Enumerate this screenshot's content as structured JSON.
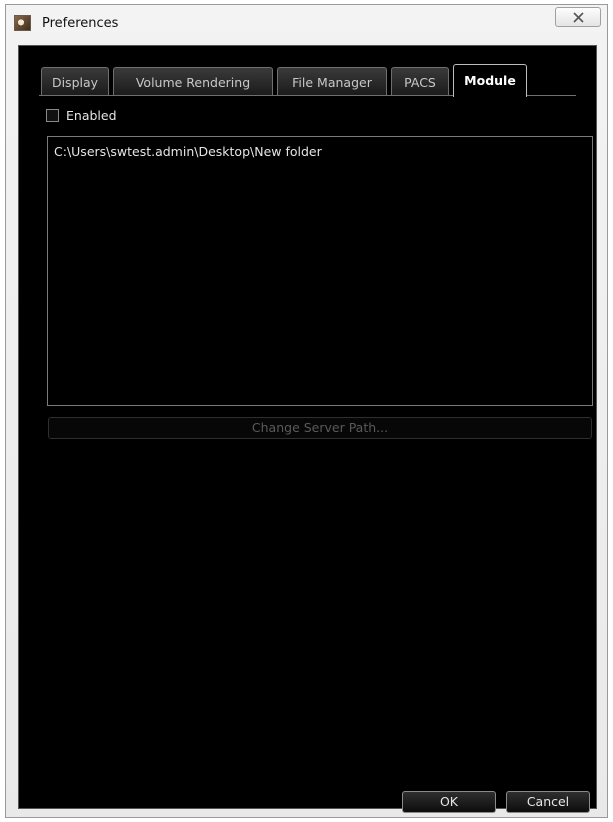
{
  "window": {
    "title": "Preferences",
    "app_icon": "preferences-app-icon",
    "close_icon": "close-x-icon"
  },
  "tabs": [
    {
      "label": "Display",
      "active": false
    },
    {
      "label": "Volume Rendering",
      "active": false
    },
    {
      "label": "File Manager",
      "active": false
    },
    {
      "label": "PACS",
      "active": false
    },
    {
      "label": "Module",
      "active": true
    }
  ],
  "module": {
    "enabled_label": "Enabled",
    "enabled_checked": false,
    "server_paths": [
      "C:\\Users\\swtest.admin\\Desktop\\New folder"
    ],
    "change_server_path_label": "Change Server Path...",
    "change_server_path_enabled": false
  },
  "buttons": {
    "ok": "OK",
    "cancel": "Cancel"
  },
  "colors": {
    "panel_background": "#000000",
    "window_chrome": "#ececec",
    "text": "#e6e6e6",
    "disabled_text": "#5a5a5a",
    "border": "#6f6f6f"
  }
}
